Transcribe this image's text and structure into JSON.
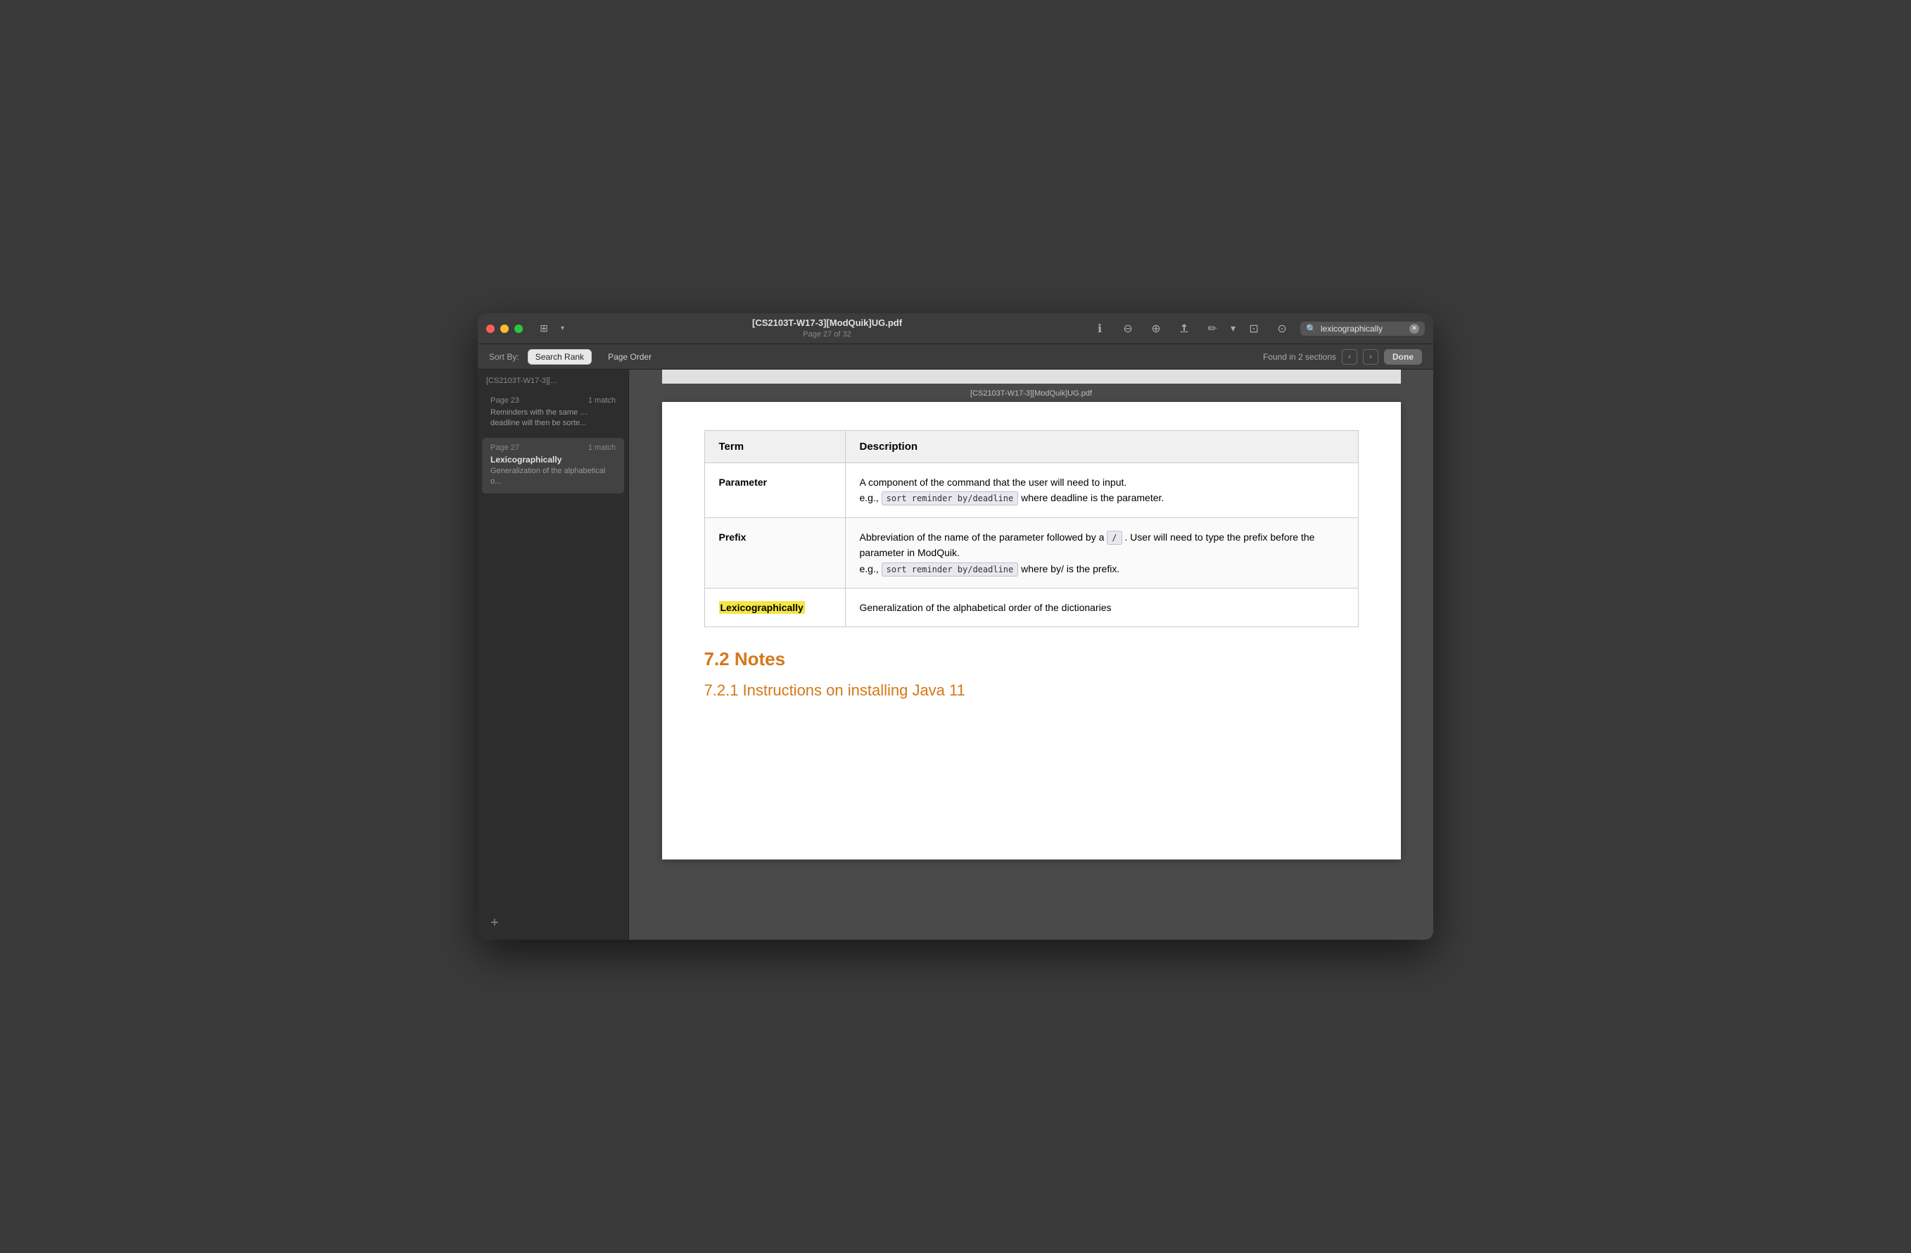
{
  "window": {
    "doc_title": "[CS2103T-W17-3][ModQuik]UG.pdf",
    "doc_subtitle": "Page 27 of 32",
    "doc_label": "[CS2103T-W17-3][ModQuik]UG.pdf"
  },
  "titlebar": {
    "sidebar_toggle": "☰",
    "zoom_out": "−",
    "zoom_in": "+",
    "share": "↑",
    "annotate": "✏",
    "window": "⊡",
    "search_icon": "🔍",
    "search_placeholder": "lexicographically",
    "search_value": "lexicographically",
    "clear": "✕"
  },
  "search_toolbar": {
    "sort_label": "Sort By:",
    "sort_search_rank": "Search Rank",
    "sort_page_order": "Page Order",
    "found_text": "Found in 2 sections",
    "nav_prev": "‹",
    "nav_next": "›",
    "done": "Done"
  },
  "sidebar": {
    "filename": "[CS2103T-W17-3][...",
    "items": [
      {
        "page": "Page 23",
        "match_count": "1 match",
        "title": "",
        "preview": "Reminders with the same … deadline will then be sorte..."
      },
      {
        "page": "Page 27",
        "match_count": "1 match",
        "title": "Lexicographically",
        "preview": "Generalization of the alphabetical o..."
      }
    ],
    "add_btn": "+"
  },
  "pdf": {
    "page_label": "[CS2103T-W17-3][ModQuik]UG.pdf",
    "table": {
      "headers": [
        "Term",
        "Description"
      ],
      "rows": [
        {
          "term": "Parameter",
          "description_parts": [
            "A component of the command that the user will need to input.",
            "e.g., ",
            "sort reminder by/deadline",
            " where deadline is the parameter."
          ]
        },
        {
          "term": "Prefix",
          "description_parts": [
            "Abbreviation of the name of the parameter followed by a ",
            "/",
            " . User will need to type the prefix before the parameter in ModQuik.",
            " e.g., ",
            "sort reminder by/deadline",
            " where by/ is the prefix."
          ]
        },
        {
          "term": "Lexicographically",
          "term_highlighted": true,
          "description": "Generalization of the alphabetical order of the dictionaries"
        }
      ]
    },
    "section_title": "7.2 Notes",
    "section_subtitle": "7.2.1 Instructions on installing Java 11"
  }
}
